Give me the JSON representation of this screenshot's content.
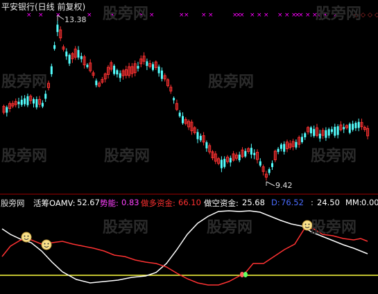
{
  "title": "平安银行(日线 前复权)",
  "price_high_label": "13.38",
  "price_low_label": "9.42",
  "watermark": "股旁网",
  "colors": {
    "up": "#ff3232",
    "down": "#54ffff",
    "mark": "#ff00ff",
    "white": "#ffffff",
    "yellow": "#ffff40"
  },
  "indicator": {
    "source": "股旁网",
    "name": "活筹OAMV:",
    "oamv": "52.67",
    "energy_label": "势能:",
    "energy": "0.83",
    "long_label": "做多资金:",
    "long": "66.10",
    "short_label": "做空资金:",
    "short": "25.68",
    "d_label": "D:",
    "d": "76.52",
    "e_label": ":",
    "e": "24.50",
    "mm_label": "MM:",
    "mm": "0.00"
  },
  "chart_data": {
    "type": "candlestick",
    "price_range": [
      9.2,
      13.7
    ],
    "high": 13.38,
    "low": 9.42,
    "indicator_range": [
      0,
      100
    ],
    "yellow_level": 12
  }
}
